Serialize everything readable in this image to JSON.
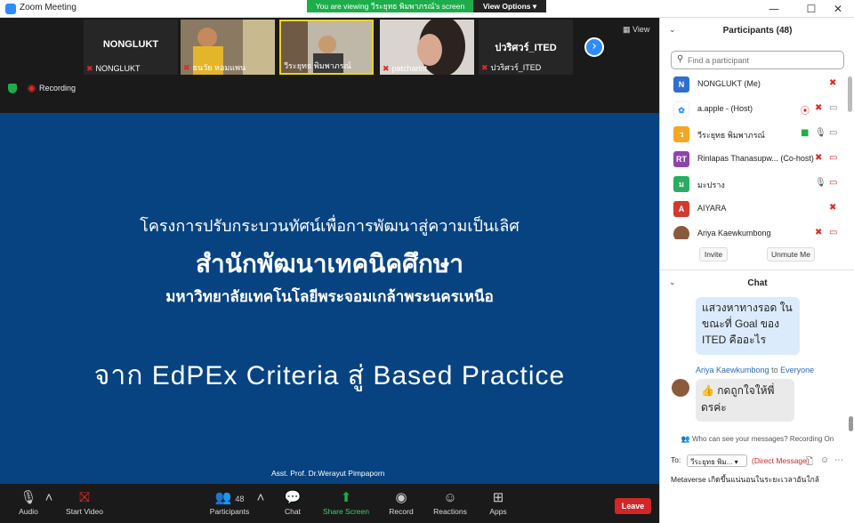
{
  "window": {
    "title": "Zoom Meeting",
    "controls": [
      "—",
      "☐",
      "✕"
    ]
  },
  "share_banner": {
    "text": "You are viewing วีระยุทธ พิมพาภรณ์'s screen",
    "view_options": "View Options ▾"
  },
  "video_strip": {
    "tiles": [
      {
        "big_name": "NONGLUKT",
        "label": "NONGLUKT"
      },
      {
        "big_name": "",
        "label": "ธนวัย หอมแพน"
      },
      {
        "big_name": "",
        "label": "วีระยุทธ พิมพาภรณ์"
      },
      {
        "big_name": "",
        "label": "patcharint"
      },
      {
        "big_name": "ปวริศวร์_ITED",
        "label": "ปวริศวร์_ITED"
      }
    ],
    "view_label": "View"
  },
  "status": {
    "recording": "Recording"
  },
  "slide": {
    "line1": "โครงการปรับกระบวนทัศน์เพื่อการพัฒนาสู่ความเป็นเลิศ",
    "line2": "สำนักพัฒนาเทคนิคศึกษา",
    "line3": "มหาวิทยาลัยเทคโนโลยีพระจอมเกล้าพระนครเหนือ",
    "line4": "จาก EdPEx Criteria สู่ Based Practice",
    "author": "Asst. Prof. Dr.Werayut Pimpaporn"
  },
  "toolbar": {
    "audio": "Audio",
    "video": "Start Video",
    "participants": "Participants",
    "participants_count": "48",
    "chat": "Chat",
    "share": "Share Screen",
    "record": "Record",
    "reactions": "Reactions",
    "apps": "Apps",
    "leave": "Leave"
  },
  "participants_panel": {
    "title": "Participants (48)",
    "search_placeholder": "Find a participant",
    "participants": [
      {
        "initial": "N",
        "name": "NONGLUKT (Me)",
        "color": "#2f6fcf"
      },
      {
        "initial": "",
        "name": "a.apple - (Host)",
        "color": "#ffffff"
      },
      {
        "initial": "ว",
        "name": "วีระยุทธ พิมพาภรณ์",
        "color": "#f5a623"
      },
      {
        "initial": "RT",
        "name": "Rinlapas Thanasupw...  (Co-host)",
        "color": "#8e44ad"
      },
      {
        "initial": "ม",
        "name": "มะปราง",
        "color": "#27ae60"
      },
      {
        "initial": "A",
        "name": "AIYARA",
        "color": "#d13b2f"
      },
      {
        "initial": "",
        "name": "Ariya Kaewkumbong",
        "color": "#8a5a3a"
      }
    ],
    "invite": "Invite",
    "unmute_me": "Unmute Me"
  },
  "chat_panel": {
    "title": "Chat",
    "message1": "แสวงหาทางรอด ในขณะที่ Goal ของ ITED คืออะไร",
    "sender": "Ariya Kaewkumbong",
    "to": "to",
    "recipient": "Everyone",
    "message2": "👍 กดถูกใจให้พี่ ดรค่ะ",
    "who_can_see": "Who can see your messages? Recording On",
    "to_label": "To:",
    "to_select": "วีระยุทธ พิม... ▾",
    "direct_message": "(Direct Message)",
    "typed_text": "Metaverse เกิดขึ้นแน่นอนในระยะเวลาอันใกล้"
  },
  "colors": {
    "slide_bg": "#074381",
    "accent_blue": "#2d8cff",
    "leave_red": "#d12727",
    "share_green": "#1ead4b"
  }
}
